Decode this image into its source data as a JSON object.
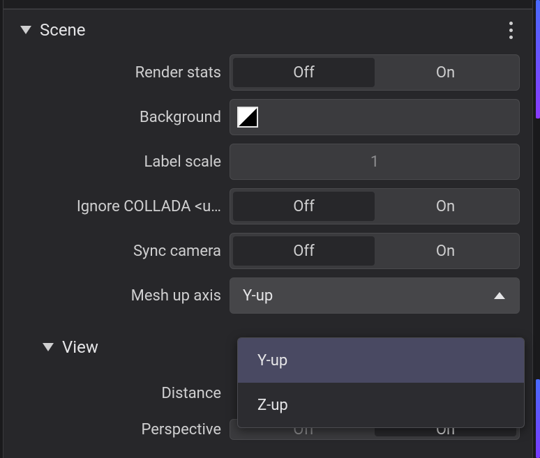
{
  "toggle": {
    "off": "Off",
    "on": "On"
  },
  "scene": {
    "title": "Scene",
    "render_stats_label": "Render stats",
    "background_label": "Background",
    "label_scale_label": "Label scale",
    "label_scale_value": "1",
    "ignore_collada_label": "Ignore COLLADA <u…",
    "sync_camera_label": "Sync camera",
    "mesh_up_axis_label": "Mesh up axis",
    "mesh_up_axis_value": "Y-up",
    "mesh_up_axis_options": {
      "y": "Y-up",
      "z": "Z-up"
    }
  },
  "view": {
    "title": "View",
    "distance_label": "Distance",
    "perspective_label": "Perspective"
  }
}
